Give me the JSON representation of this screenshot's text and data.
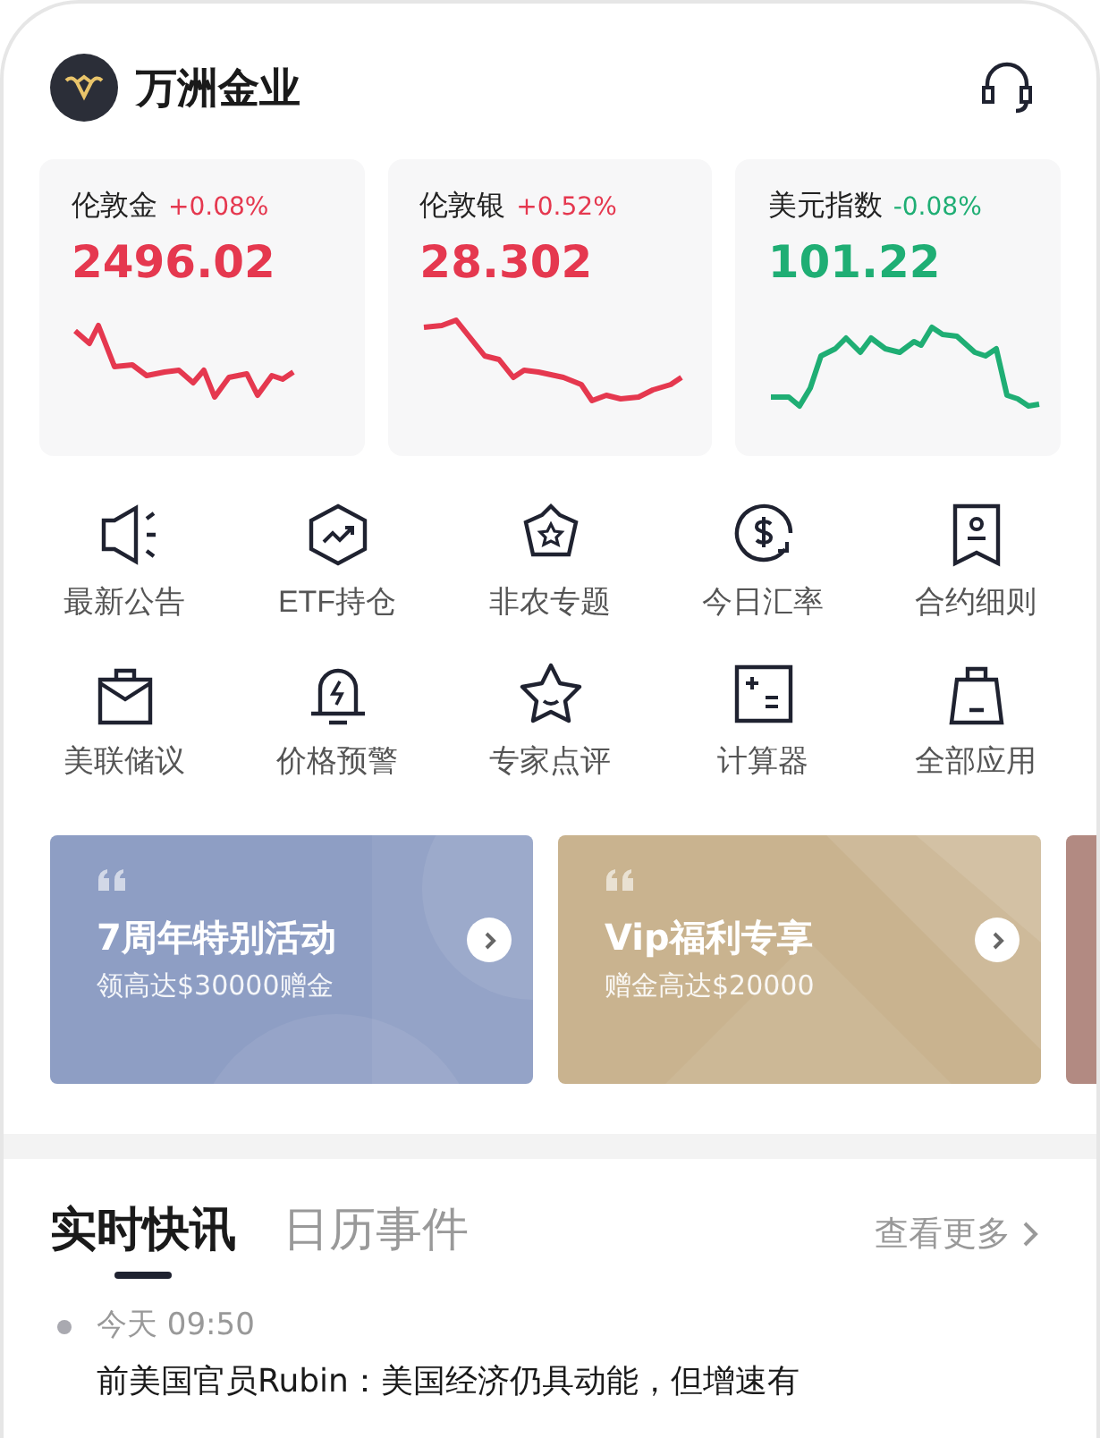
{
  "header": {
    "title": "万洲金业"
  },
  "quotes": [
    {
      "name": "伦敦金",
      "change": "+0.08%",
      "price": "2496.02",
      "color": "#e5384f"
    },
    {
      "name": "伦敦银",
      "change": "+0.52%",
      "price": "28.302",
      "color": "#e5384f"
    },
    {
      "name": "美元指数",
      "change": "-0.08%",
      "price": "101.22",
      "color": "#1fae74"
    }
  ],
  "shortcuts": [
    {
      "label": "最新公告"
    },
    {
      "label": "ETF持仓"
    },
    {
      "label": "非农专题"
    },
    {
      "label": "今日汇率"
    },
    {
      "label": "合约细则"
    },
    {
      "label": "美联储议"
    },
    {
      "label": "价格预警"
    },
    {
      "label": "专家点评"
    },
    {
      "label": "计算器"
    },
    {
      "label": "全部应用"
    }
  ],
  "banners": [
    {
      "title": "7周年特别活动",
      "subtitle": "领高达$30000赠金",
      "color": "#8e9ec4"
    },
    {
      "title": "Vip福利专享",
      "subtitle": "赠金高达$20000",
      "color": "#c9b38f"
    }
  ],
  "tabs": [
    {
      "label": "实时快讯",
      "selected": true
    },
    {
      "label": "日历事件",
      "selected": false
    }
  ],
  "more_link": "查看更多",
  "news": [
    {
      "time": "今天 09:50",
      "text": "前美国官员Rubin：美国经济仍具动能，但增速有"
    }
  ]
}
